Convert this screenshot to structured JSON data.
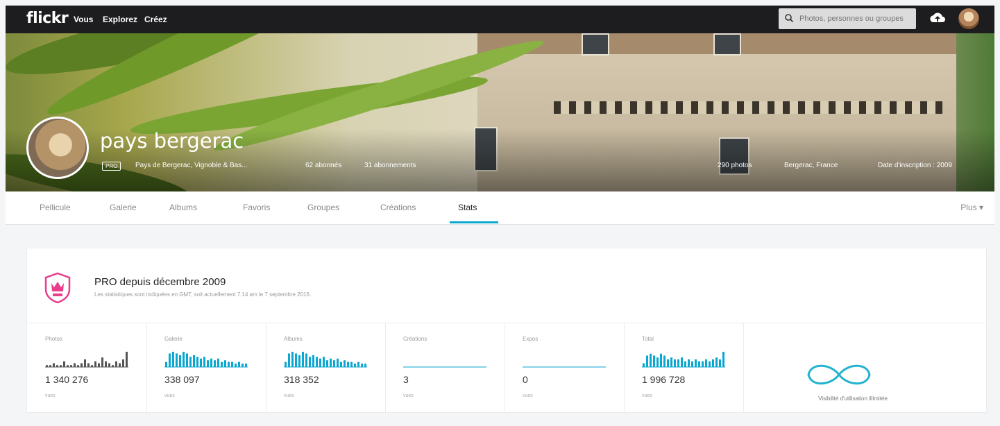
{
  "nav": {
    "logo": "flickr",
    "links": [
      "Vous",
      "Explorez",
      "Créez"
    ],
    "search_placeholder": "Photos, personnes ou groupes"
  },
  "profile": {
    "name": "pays bergerac",
    "pro_badge": "PRO",
    "description": "Pays de Bergerac, Vignoble & Bas...",
    "followers": "62 abonnés",
    "following": "31 abonnements",
    "photos_count": "290 photos",
    "location": "Bergerac, France",
    "joined": "Date d'inscription : 2009"
  },
  "tabs": [
    "Pellicule",
    "Galerie",
    "Albums",
    "Favoris",
    "Groupes",
    "Créations",
    "Stats"
  ],
  "active_tab": "Stats",
  "more_label": "Plus ▾",
  "pro_banner": {
    "title": "PRO depuis décembre 2009",
    "subtitle": "Les statistiques sont indiquées en GMT, soit actuellement 7:14 am le 7 septembre 2016."
  },
  "stats": [
    {
      "label": "Photos",
      "value": "1 340 276",
      "unit": "vues",
      "spark": [
        1,
        1,
        2,
        1,
        1,
        3,
        1,
        1,
        2,
        1,
        2,
        4,
        2,
        1,
        3,
        2,
        5,
        3,
        2,
        1,
        3,
        2,
        4,
        8
      ]
    },
    {
      "label": "Galerie",
      "value": "338 097",
      "unit": "vues",
      "spark": [
        3,
        8,
        9,
        8,
        7,
        9,
        8,
        6,
        7,
        6,
        5,
        6,
        4,
        5,
        4,
        5,
        3,
        4,
        3,
        3,
        2,
        3,
        2,
        2
      ]
    },
    {
      "label": "Albums",
      "value": "318 352",
      "unit": "vues",
      "spark": [
        3,
        8,
        9,
        8,
        7,
        9,
        8,
        6,
        7,
        6,
        5,
        6,
        4,
        5,
        4,
        5,
        3,
        4,
        3,
        3,
        2,
        3,
        2,
        2
      ]
    },
    {
      "label": "Créations",
      "value": "3",
      "unit": "vues",
      "spark": [
        0,
        0,
        0,
        0,
        0,
        0,
        0,
        0,
        0,
        0,
        0,
        0,
        0,
        0,
        0,
        0,
        0,
        0,
        0,
        0,
        0,
        0,
        0,
        0
      ]
    },
    {
      "label": "Expos",
      "value": "0",
      "unit": "vues",
      "spark": [
        0,
        0,
        0,
        0,
        0,
        0,
        0,
        0,
        0,
        0,
        0,
        0,
        0,
        0,
        0,
        0,
        0,
        0,
        0,
        0,
        0,
        0,
        0,
        0
      ]
    },
    {
      "label": "Total",
      "value": "1 996 728",
      "unit": "vues",
      "spark": [
        2,
        6,
        7,
        6,
        5,
        7,
        6,
        4,
        5,
        4,
        4,
        5,
        3,
        4,
        3,
        4,
        3,
        3,
        4,
        3,
        4,
        5,
        4,
        8
      ]
    }
  ],
  "unlimited_label": "Visibilité d'utilisation illimitée",
  "colors": {
    "accent": "#0aa7d1",
    "pro": "#e83e8c",
    "bar": "#212124"
  }
}
